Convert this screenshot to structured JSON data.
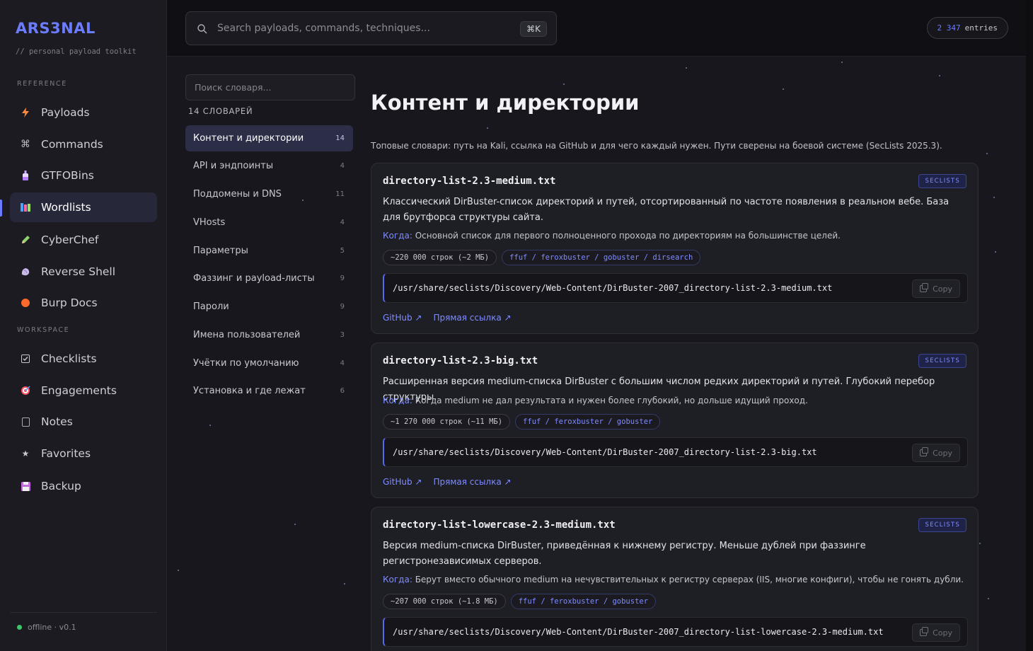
{
  "app": {
    "brand": "ARS3NAL",
    "tagline": "// personal payload toolkit",
    "status": "offline · v0.1"
  },
  "sidebar": {
    "reference_label": "REFERENCE",
    "workspace_label": "WORKSPACE",
    "reference_items": [
      {
        "label": "Payloads",
        "icon": "bolt-icon"
      },
      {
        "label": "Commands",
        "icon": "command-icon"
      },
      {
        "label": "GTFOBins",
        "icon": "bottle-icon"
      },
      {
        "label": "Wordlists",
        "icon": "books-icon",
        "active": true
      },
      {
        "label": "CyberChef",
        "icon": "pencil-icon"
      },
      {
        "label": "Reverse Shell",
        "icon": "shell-icon"
      },
      {
        "label": "Burp Docs",
        "icon": "burp-icon"
      }
    ],
    "workspace_items": [
      {
        "label": "Checklists",
        "icon": "checkbox-icon"
      },
      {
        "label": "Engagements",
        "icon": "target-icon"
      },
      {
        "label": "Notes",
        "icon": "note-icon"
      },
      {
        "label": "Favorites",
        "icon": "star-icon"
      },
      {
        "label": "Backup",
        "icon": "floppy-icon"
      }
    ]
  },
  "topbar": {
    "search_placeholder": "Search payloads, commands, techniques...",
    "shortcut": "⌘K",
    "entries_count": "2 347",
    "entries_label": "entries"
  },
  "dictionaries": {
    "search_placeholder": "Поиск словаря...",
    "count_label": "14 СЛОВАРЕЙ",
    "items": [
      {
        "label": "Контент и директории",
        "count": "14",
        "active": true
      },
      {
        "label": "API и эндпоинты",
        "count": "4"
      },
      {
        "label": "Поддомены и DNS",
        "count": "11"
      },
      {
        "label": "VHosts",
        "count": "4"
      },
      {
        "label": "Параметры",
        "count": "5"
      },
      {
        "label": "Фаззинг и payload-листы",
        "count": "9"
      },
      {
        "label": "Пароли",
        "count": "9"
      },
      {
        "label": "Имена пользователей",
        "count": "3"
      },
      {
        "label": "Учётки по умолчанию",
        "count": "4"
      },
      {
        "label": "Установка и где лежат",
        "count": "6"
      }
    ]
  },
  "content": {
    "title": "Контент и директории",
    "description": "Топовые словари: путь на Kali, ссылка на GitHub и для чего каждый нужен. Пути сверены на боевой системе (SecLists 2025.3).",
    "when_label": "Когда:",
    "copy_label": "Copy",
    "github_label": "GitHub ↗",
    "direct_label": "Прямая ссылка ↗",
    "cards": [
      {
        "title": "directory-list-2.3-medium.txt",
        "tag": "SECLISTS",
        "desc": "Классический DirBuster-список директорий и путей, отсортированный по частоте появления в реальном вебе. База для брутфорса структуры сайта.",
        "when": "Основной список для первого полноценного прохода по директориям на большинстве целей.",
        "size": "~220 000 строк (~2 МБ)",
        "tools": "ffuf / feroxbuster / gobuster / dirsearch",
        "path": "/usr/share/seclists/Discovery/Web-Content/DirBuster-2007_directory-list-2.3-medium.txt"
      },
      {
        "title": "directory-list-2.3-big.txt",
        "tag": "SECLISTS",
        "desc": "Расширенная версия medium-списка DirBuster с большим числом редких директорий и путей. Глубокий перебор структуры.",
        "when": "Когда medium не дал результата и нужен более глубокий, но дольше идущий проход.",
        "size": "~1 270 000 строк (~11 МБ)",
        "tools": "ffuf / feroxbuster / gobuster",
        "path": "/usr/share/seclists/Discovery/Web-Content/DirBuster-2007_directory-list-2.3-big.txt"
      },
      {
        "title": "directory-list-lowercase-2.3-medium.txt",
        "tag": "SECLISTS",
        "desc": "Версия medium-списка DirBuster, приведённая к нижнему регистру. Меньше дублей при фаззинге регистронезависимых серверов.",
        "when": "Берут вместо обычного medium на нечувствительных к регистру серверах (IIS, многие конфиги), чтобы не гонять дубли.",
        "size": "~207 000 строк (~1.8 МБ)",
        "tools": "ffuf / feroxbuster / gobuster",
        "path": "/usr/share/seclists/Discovery/Web-Content/DirBuster-2007_directory-list-lowercase-2.3-medium.txt"
      }
    ]
  },
  "colors": {
    "accent": "#6c7cff",
    "status_online": "#3fc46a"
  }
}
